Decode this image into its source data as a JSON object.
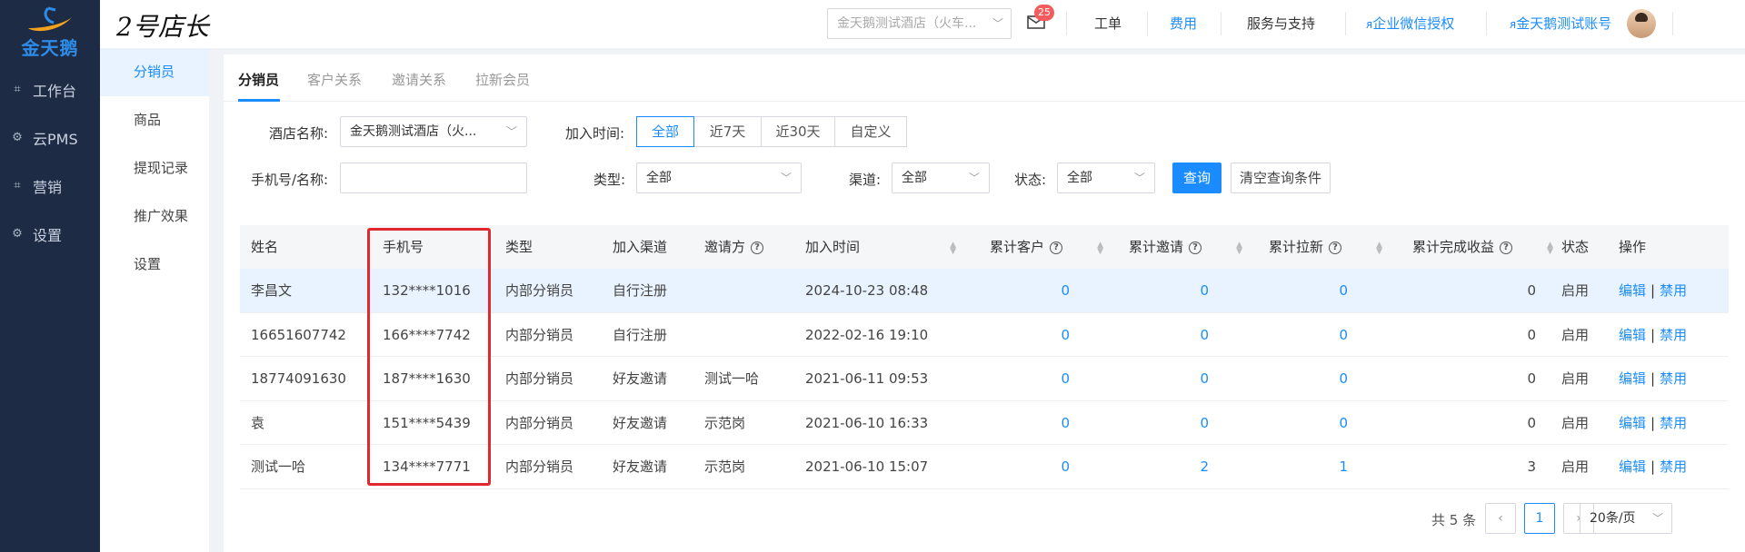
{
  "brand": {
    "logo_text": "金天鹅",
    "app_title": "2号店长",
    "accent": "#1a8cff"
  },
  "sidebar": {
    "items": [
      {
        "label": "工作台",
        "icon": "grid-icon"
      },
      {
        "label": "云PMS",
        "icon": "gear-icon"
      },
      {
        "label": "营销",
        "icon": "grid-icon"
      },
      {
        "label": "设置",
        "icon": "gear-icon"
      }
    ]
  },
  "submenu": {
    "items": [
      {
        "label": "分销员",
        "active": true
      },
      {
        "label": "商品"
      },
      {
        "label": "提现记录"
      },
      {
        "label": "推广效果"
      },
      {
        "label": "设置"
      }
    ]
  },
  "header": {
    "hotel_select": "金天鹅测试酒店（火车...",
    "mail_badge": "25",
    "links": {
      "ticket": "工单",
      "fees": "费用",
      "support": "服务与支持",
      "wechat": "企业微信授权",
      "account": "金天鹅测试账号"
    }
  },
  "tabs": [
    "分销员",
    "客户关系",
    "邀请关系",
    "拉新会员"
  ],
  "filters": {
    "hotel_label": "酒店名称:",
    "hotel_value": "金天鹅测试酒店（火...",
    "join_time_label": "加入时间:",
    "join_time_options": [
      "全部",
      "近7天",
      "近30天",
      "自定义"
    ],
    "phone_label": "手机号/名称:",
    "phone_value": "",
    "type_label": "类型:",
    "type_value": "全部",
    "channel_label": "渠道:",
    "channel_value": "全部",
    "status_label": "状态:",
    "status_value": "全部",
    "query_button": "查询",
    "clear_button": "清空查询条件"
  },
  "table": {
    "columns": [
      "姓名",
      "手机号",
      "类型",
      "加入渠道",
      "邀请方",
      "加入时间",
      "累计客户",
      "累计邀请",
      "累计拉新",
      "累计完成收益",
      "状态",
      "操作"
    ],
    "rows": [
      {
        "name": "李昌文",
        "phone": "132****1016",
        "type": "内部分销员",
        "channel": "自行注册",
        "inviter": "",
        "time": "2024-10-23 08:48",
        "customers": "0",
        "invites": "0",
        "new": "0",
        "income": "0",
        "status": "启用"
      },
      {
        "name": "16651607742",
        "phone": "166****7742",
        "type": "内部分销员",
        "channel": "自行注册",
        "inviter": "",
        "time": "2022-02-16 19:10",
        "customers": "0",
        "invites": "0",
        "new": "0",
        "income": "0",
        "status": "启用"
      },
      {
        "name": "18774091630",
        "phone": "187****1630",
        "type": "内部分销员",
        "channel": "好友邀请",
        "inviter": "测试一哈",
        "time": "2021-06-11 09:53",
        "customers": "0",
        "invites": "0",
        "new": "0",
        "income": "0",
        "status": "启用"
      },
      {
        "name": "袁",
        "phone": "151****5439",
        "type": "内部分销员",
        "channel": "好友邀请",
        "inviter": "示范岗",
        "time": "2021-06-10 16:33",
        "customers": "0",
        "invites": "0",
        "new": "0",
        "income": "0",
        "status": "启用"
      },
      {
        "name": "测试一哈",
        "phone": "134****7771",
        "type": "内部分销员",
        "channel": "好友邀请",
        "inviter": "示范岗",
        "time": "2021-06-10 15:07",
        "customers": "0",
        "invites": "2",
        "new": "1",
        "income": "3",
        "status": "启用"
      }
    ],
    "op_edit": "编辑",
    "op_sep": "|",
    "op_disable": "禁用"
  },
  "pagination": {
    "total": "共 5 条",
    "current": "1",
    "page_size": "20条/页",
    "prev": "‹",
    "next": "›"
  }
}
